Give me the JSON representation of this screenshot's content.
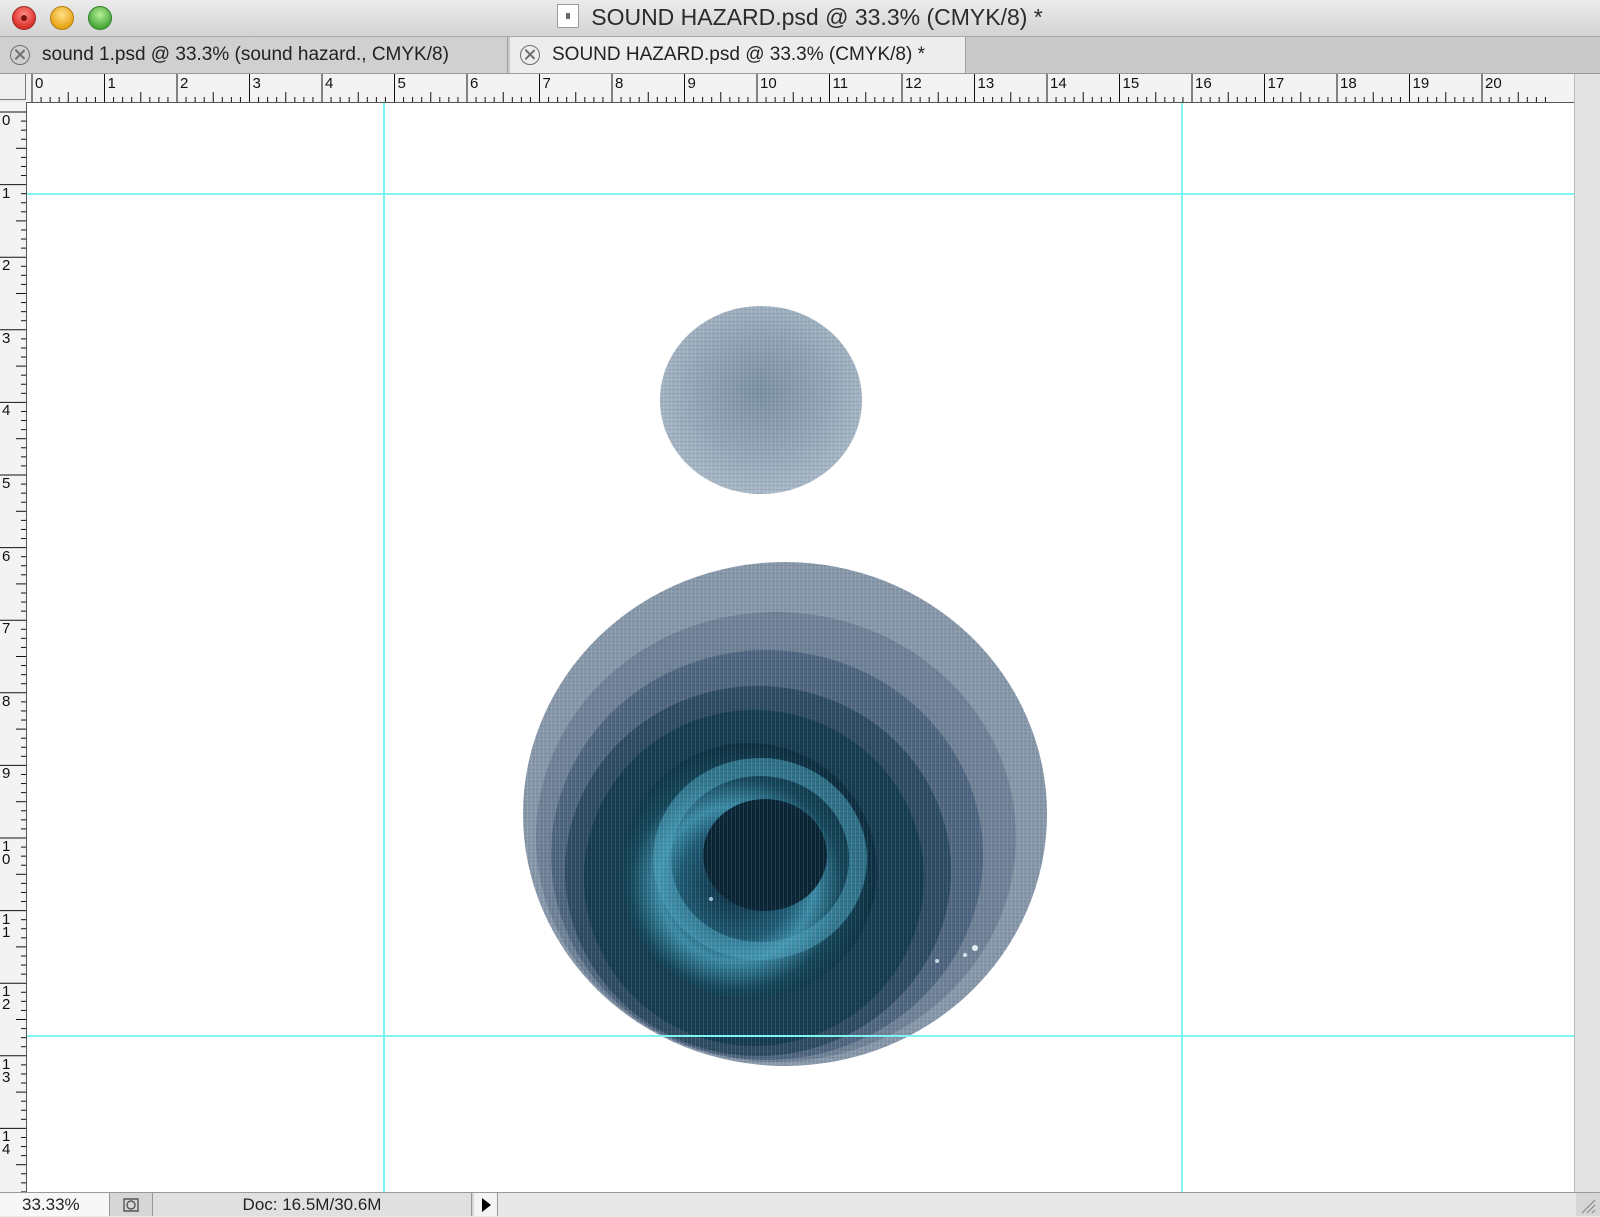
{
  "window": {
    "title": "SOUND HAZARD.psd @ 33.3% (CMYK/8) *"
  },
  "tabs": [
    {
      "label": "sound 1.psd @ 33.3% (sound hazard., CMYK/8)",
      "active": false
    },
    {
      "label": "SOUND HAZARD.psd @ 33.3% (CMYK/8) *",
      "active": true
    }
  ],
  "ruler": {
    "horizontal_labels": [
      "0",
      "1",
      "2",
      "3",
      "4",
      "5",
      "6",
      "7",
      "8",
      "9",
      "10",
      "11",
      "12",
      "13",
      "14",
      "15",
      "16",
      "17",
      "18",
      "19",
      "20"
    ],
    "vertical_labels": [
      "0",
      "1",
      "2",
      "3",
      "4",
      "5",
      "6",
      "7",
      "8",
      "9",
      "10",
      "11",
      "12",
      "13",
      "14"
    ]
  },
  "status": {
    "zoom": "33.33%",
    "doc_info": "Doc: 16.5M/30.6M"
  },
  "colors": {
    "guide": "#7ff4f4",
    "canvas": "#ffffff",
    "small_circle": "#8fa2b5",
    "big_circle_outer": "#8696a9",
    "big_circle_core": "#0d3347",
    "accent_teal": "#2f7f98"
  },
  "icons": {
    "close_window": "red traffic light",
    "minimize_window": "yellow traffic light",
    "zoom_window": "green traffic light",
    "tab_close": "circled x",
    "status_menu": "right triangle"
  }
}
